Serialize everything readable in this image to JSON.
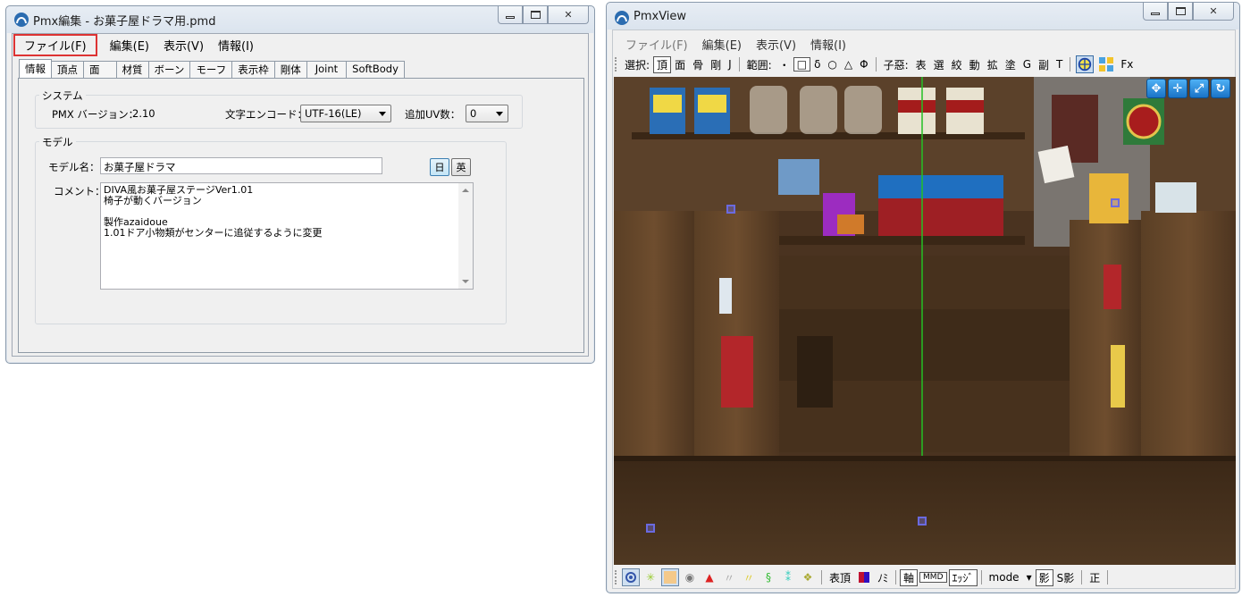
{
  "editor": {
    "title": "Pmx編集 - お菓子屋ドラマ用.pmd",
    "menu": [
      "ファイル(F)",
      "編集(E)",
      "表示(V)",
      "情報(I)"
    ],
    "tabs": [
      "情報",
      "頂点",
      "面",
      "材質",
      "ボーン",
      "モーフ",
      "表示枠",
      "剛体",
      "Joint",
      "SoftBody"
    ],
    "active_tab": "情報",
    "system_group": "システム",
    "pmx_version_label": "PMX バージョン：",
    "pmx_version_value": "2.10",
    "encoding_label": "文字エンコード：",
    "encoding_value": "UTF-16(LE)",
    "uv_label": "追加UV数：",
    "uv_value": "0",
    "model_group": "モデル",
    "model_name_label": "モデル名：",
    "model_name_value": "お菓子屋ドラマ",
    "lang_jp": "日",
    "lang_en": "英",
    "comment_label": "コメント：",
    "comment_lines": [
      "DIVA風お菓子屋ステージVer1.01",
      "椅子が動くバージョン",
      "",
      "製作azaidoue",
      "1.01ドア小物類がセンターに追従するように変更"
    ]
  },
  "viewer": {
    "title": "PmxView",
    "menu": [
      "ファイル(F)",
      "編集(E)",
      "表示(V)",
      "情報(I)"
    ],
    "toolbar": {
      "select_label": "選択:",
      "select_items": [
        "頂",
        "面",
        "骨",
        "剛",
        "J"
      ],
      "range_label": "範囲:",
      "range_items": [
        "・",
        "□",
        "δ",
        "○",
        "△",
        "Φ"
      ],
      "child_label": "子惡:",
      "child_items": [
        "表",
        "選",
        "絞",
        "動",
        "拡",
        "塗",
        "G",
        "副",
        "T"
      ],
      "fx_label": "Fx"
    },
    "bottom": {
      "items": [
        "表頂",
        "ﾉﾐ"
      ],
      "edge_label": "ｴｯｼﾞ",
      "mode_label": "mode",
      "shadow_label": "影",
      "sshadow_label": "S影",
      "ortho_label": "正",
      "axis_label": "軸",
      "mmd_label": "MMD"
    }
  }
}
